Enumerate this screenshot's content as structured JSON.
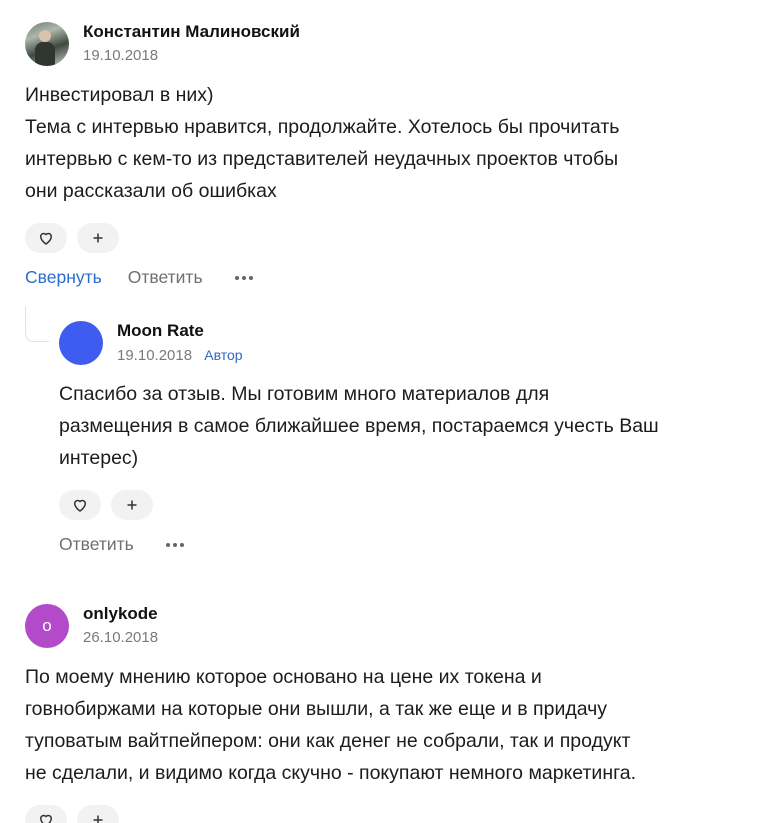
{
  "comments": [
    {
      "author": "Константин Малиновский",
      "date": "19.10.2018",
      "lines": [
        "Инвестировал в них)",
        "Тема с интервью нравится, продолжайте. Хотелось бы прочитать",
        "интервью с кем-то из представителей неудачных проектов чтобы",
        "они рассказали об ошибках"
      ],
      "collapse_label": "Свернуть",
      "reply_label": "Ответить"
    },
    {
      "author": "Moon Rate",
      "date": "19.10.2018",
      "badge": "Автор",
      "lines": [
        "Спасибо за отзыв. Мы готовим много материалов для",
        "размещения в самое ближайшее время, постараемся учесть Ваш",
        "интерес)"
      ],
      "reply_label": "Ответить"
    },
    {
      "author": "onlykode",
      "avatar_letter": "o",
      "date": "26.10.2018",
      "lines": [
        "По моему мнению которое основано на цене их токена и",
        "говнобиржами на которые они вышли, а так же еще и в придачу",
        "туповатым вайтпейпером: они как денег не собрали, так и продукт",
        "не сделали, и видимо когда скучно - покупают немного маркетинга."
      ]
    }
  ],
  "icons": {
    "like": "heart-icon",
    "add_reaction": "plus-icon",
    "more": "more-dots-icon"
  },
  "colors": {
    "link": "#2c6cd1",
    "muted": "#7a7a7a",
    "pill_bg": "#f2f2f2",
    "avatar_blue": "#3f5cf0",
    "avatar_purple": "#b24ac9"
  }
}
